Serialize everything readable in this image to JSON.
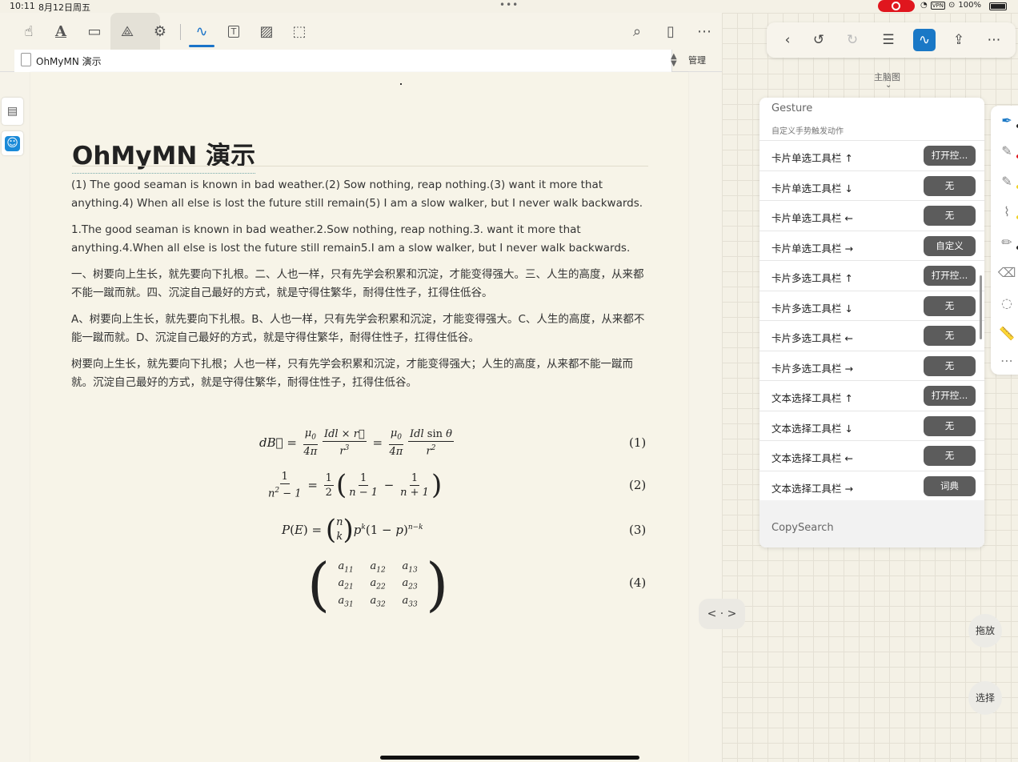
{
  "status_bar": {
    "time": "10:11",
    "date": "8月12日周五",
    "vpn": "VPN",
    "battery": "100%"
  },
  "tab": {
    "title": "OhMyMN 演示",
    "manage_label": "管理"
  },
  "document": {
    "title": "OhMyMN 演示",
    "paragraphs": [
      "(1) The good seaman is known in bad weather.(2) Sow nothing, reap nothing.(3) want it more that anything.4) When all else is lost the future still remain(5) I am a slow walker, but I never walk backwards.",
      "1.The good seaman is known in bad weather.2.Sow nothing, reap nothing.3. want it more that anything.4.When all else is lost the future still remain5.I am a slow walker, but I never walk backwards.",
      "一、树要向上生长，就先要向下扎根。二、人也一样，只有先学会积累和沉淀，才能变得强大。三、人生的高度，从来都不能一蹴而就。四、沉淀自己最好的方式，就是守得住繁华，耐得住性子，扛得住低谷。",
      "A、树要向上生长，就先要向下扎根。B、人也一样，只有先学会积累和沉淀，才能变得强大。C、人生的高度，从来都不能一蹴而就。D、沉淀自己最好的方式，就是守得住繁华，耐得住性子，扛得住低谷。",
      "树要向上生长，就先要向下扎根；人也一样，只有先学会积累和沉淀，才能变得强大；人生的高度，从来都不能一蹴而就。沉淀自己最好的方式，就是守得住繁华，耐得住性子，扛得住低谷。"
    ],
    "equation_numbers": [
      "(1)",
      "(2)",
      "(3)",
      "(4)"
    ]
  },
  "right_panel": {
    "mindmap_label": "主脑图",
    "gesture": {
      "title": "Gesture",
      "subtitle": "自定义手势触发动作",
      "rows": [
        {
          "label": "卡片单选工具栏 ↑",
          "action": "打开控..."
        },
        {
          "label": "卡片单选工具栏 ↓",
          "action": "无"
        },
        {
          "label": "卡片单选工具栏 ←",
          "action": "无"
        },
        {
          "label": "卡片单选工具栏 →",
          "action": "自定义"
        },
        {
          "label": "卡片多选工具栏 ↑",
          "action": "打开控..."
        },
        {
          "label": "卡片多选工具栏 ↓",
          "action": "无"
        },
        {
          "label": "卡片多选工具栏 ←",
          "action": "无"
        },
        {
          "label": "卡片多选工具栏 →",
          "action": "无"
        },
        {
          "label": "文本选择工具栏 ↑",
          "action": "打开控..."
        },
        {
          "label": "文本选择工具栏 ↓",
          "action": "无"
        },
        {
          "label": "文本选择工具栏 ←",
          "action": "无"
        },
        {
          "label": "文本选择工具栏 →",
          "action": "词典"
        }
      ]
    },
    "copysearch": {
      "title": "CopySearch"
    },
    "drag_label": "拖放",
    "select_label": "选择",
    "nav_arrows": "< · >"
  },
  "colors": {
    "accent": "#1a78c6",
    "record": "#e0161e",
    "pen_red": "#e0161e",
    "pen_yellow": "#f0d020",
    "pen_dark": "#222222",
    "action_button": "#5c5c5c"
  }
}
